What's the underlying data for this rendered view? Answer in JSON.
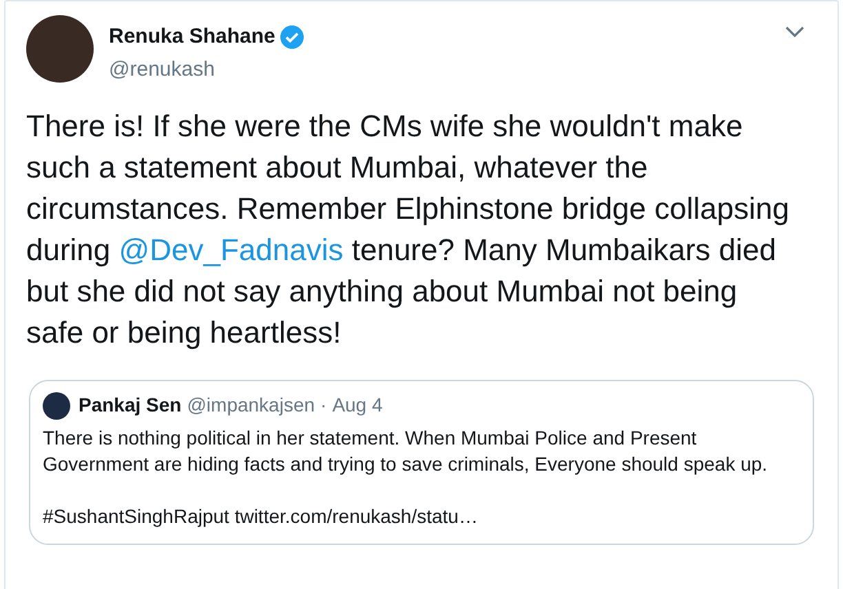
{
  "tweet": {
    "author": {
      "name": "Renuka Shahane",
      "handle": "@renukash",
      "verified": true
    },
    "text_parts": [
      {
        "kind": "text",
        "text": "There is! If she were the CMs wife she wouldn't make such a statement about Mumbai, whatever the circumstances. Remember Elphinstone bridge collapsing during "
      },
      {
        "kind": "mention",
        "text": "@Dev_Fadnavis"
      },
      {
        "kind": "text",
        "text": " tenure? Many Mumbaikars died but she did not say anything about Mumbai not being safe or being heartless!"
      }
    ],
    "quoted_tweet": {
      "author": {
        "name": "Pankaj Sen",
        "handle": "@impankajsen"
      },
      "separator": "·",
      "date": "Aug 4",
      "paragraphs": [
        "There is nothing political in her statement. When Mumbai Police and Present Government are hiding facts and trying to save criminals, Everyone should speak up.",
        "#SushantSinghRajput twitter.com/renukash/statu…"
      ]
    }
  }
}
